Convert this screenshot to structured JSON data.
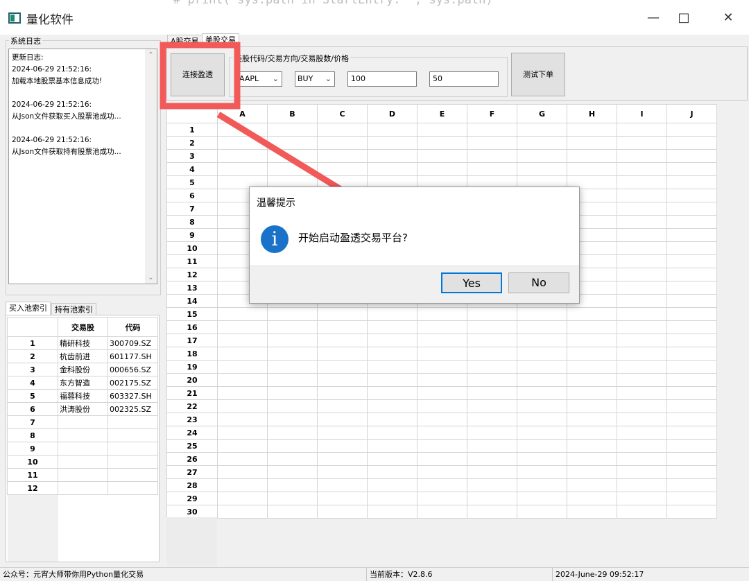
{
  "window": {
    "title": "量化软件",
    "background_code": "# print(\"sys.path in StartEntry: \", sys.path)"
  },
  "log": {
    "group_label": "系统日志",
    "content": "更新日志:\n2024-06-29 21:52:16:\n加载本地股票基本信息成功!\n\n2024-06-29 21:52:16:\n从Json文件获取买入股票池成功...\n\n2024-06-29 21:52:16:\n从Json文件获取持有股票池成功..."
  },
  "pool_tabs": {
    "buy": "买入池索引",
    "hold": "持有池索引"
  },
  "pool_table": {
    "headers": [
      "交易股",
      "代码"
    ],
    "rows": [
      {
        "num": "1",
        "name": "精研科技",
        "code": "300709.SZ"
      },
      {
        "num": "2",
        "name": "杭齿前进",
        "code": "601177.SH"
      },
      {
        "num": "3",
        "name": "金科股份",
        "code": "000656.SZ"
      },
      {
        "num": "4",
        "name": "东方智造",
        "code": "002175.SZ"
      },
      {
        "num": "5",
        "name": "福蓉科技",
        "code": "603327.SH"
      },
      {
        "num": "6",
        "name": "洪涛股份",
        "code": "002325.SZ"
      },
      {
        "num": "7",
        "name": "",
        "code": ""
      },
      {
        "num": "8",
        "name": "",
        "code": ""
      },
      {
        "num": "9",
        "name": "",
        "code": ""
      },
      {
        "num": "10",
        "name": "",
        "code": ""
      },
      {
        "num": "11",
        "name": "",
        "code": ""
      },
      {
        "num": "12",
        "name": "",
        "code": ""
      }
    ]
  },
  "trade_tabs": {
    "a_share": "A股交易",
    "us_share": "美股交易"
  },
  "trade": {
    "connect_label": "连接盈透",
    "params_label": "美股代码/交易方向/交易股数/价格",
    "symbol": "AAPL",
    "direction": "BUY",
    "shares": "100",
    "price": "50",
    "test_order_label": "测试下单"
  },
  "grid": {
    "columns": [
      "A",
      "B",
      "C",
      "D",
      "E",
      "F",
      "G",
      "H",
      "I",
      "J"
    ],
    "row_count": 30
  },
  "dialog": {
    "title": "温馨提示",
    "message": "开始启动盈透交易平台?",
    "yes_label": "Yes",
    "no_label": "No",
    "icon": "information-icon"
  },
  "status": {
    "left": "公众号：元宵大师带你用Python量化交易",
    "version": "当前版本：V2.8.6",
    "time": "2024-June-29 09:52:17"
  },
  "annotation": {
    "highlight_color": "#f25a5a"
  }
}
